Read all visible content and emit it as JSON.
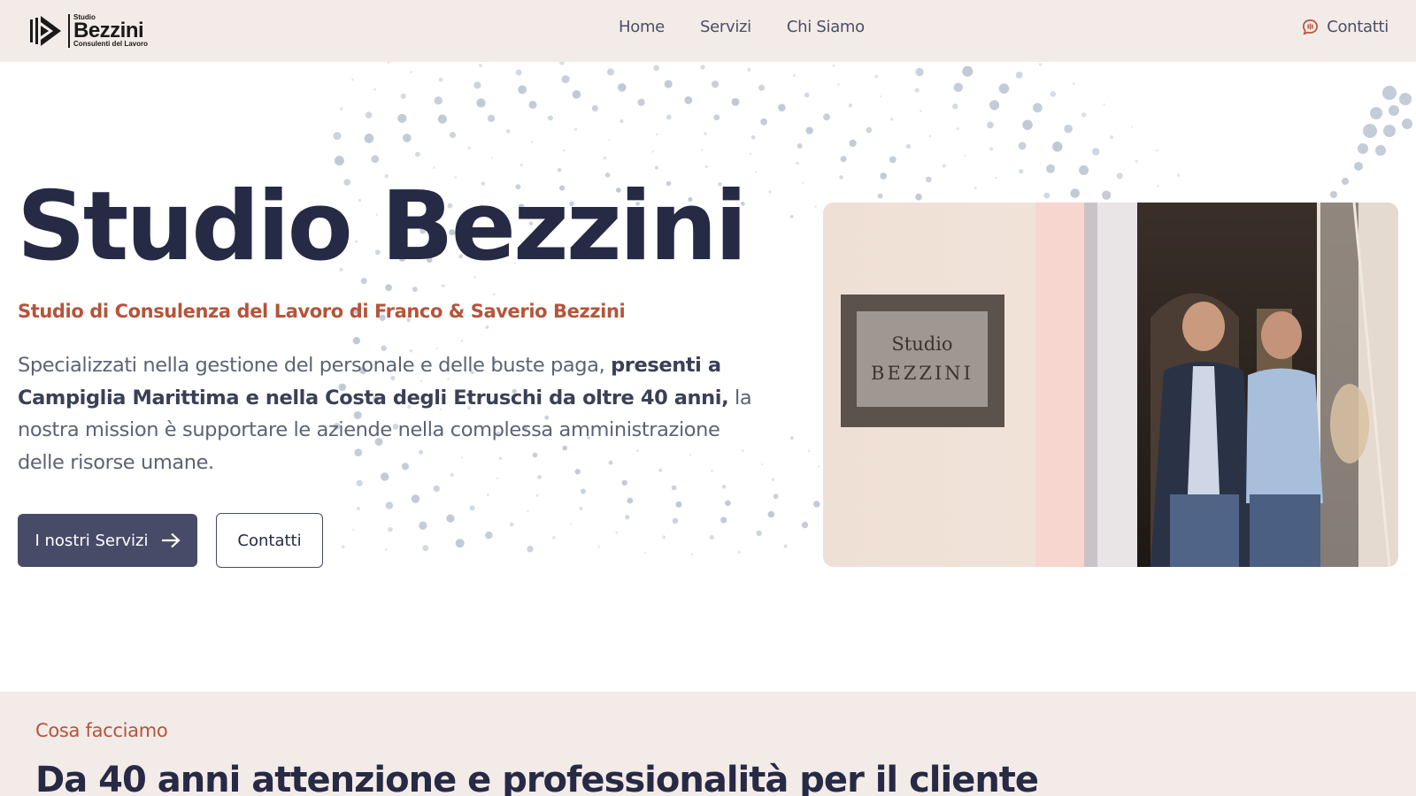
{
  "header": {
    "logo": {
      "small": "Studio",
      "name": "Bezzini",
      "tagline": "Consulenti del Lavoro"
    },
    "nav": [
      {
        "label": "Home"
      },
      {
        "label": "Servizi"
      },
      {
        "label": "Chi Siamo"
      }
    ],
    "contact": {
      "label": "Contatti",
      "icon": "chat-bubble-icon"
    }
  },
  "hero": {
    "title": "Studio Bezzini",
    "subtitle": "Studio di Consulenza del Lavoro di Franco & Saverio Bezzini",
    "description": {
      "part1": "Specializzati nella gestione del personale e delle buste paga, ",
      "bold": "presenti a Campiglia Marittima e nella Costa degli Etruschi da oltre 40 anni,",
      "part2": " la nostra mission è supportare le aziende nella complessa amministrazione delle risorse umane."
    },
    "primary_button": {
      "label": "I nostri Servizi",
      "icon": "arrow-right-icon"
    },
    "secondary_button": {
      "label": "Contatti"
    },
    "photo": {
      "plaque_line1": "Studio",
      "plaque_line2": "BEZZINI"
    }
  },
  "section": {
    "kicker": "Cosa facciamo",
    "title": "Da 40 anni attenzione e professionalità per il cliente"
  },
  "colors": {
    "navy": "#262a45",
    "accent": "#b5543a",
    "header_bg": "#f3ebe7",
    "button": "#474b68",
    "dots": "#b9c3d1"
  }
}
